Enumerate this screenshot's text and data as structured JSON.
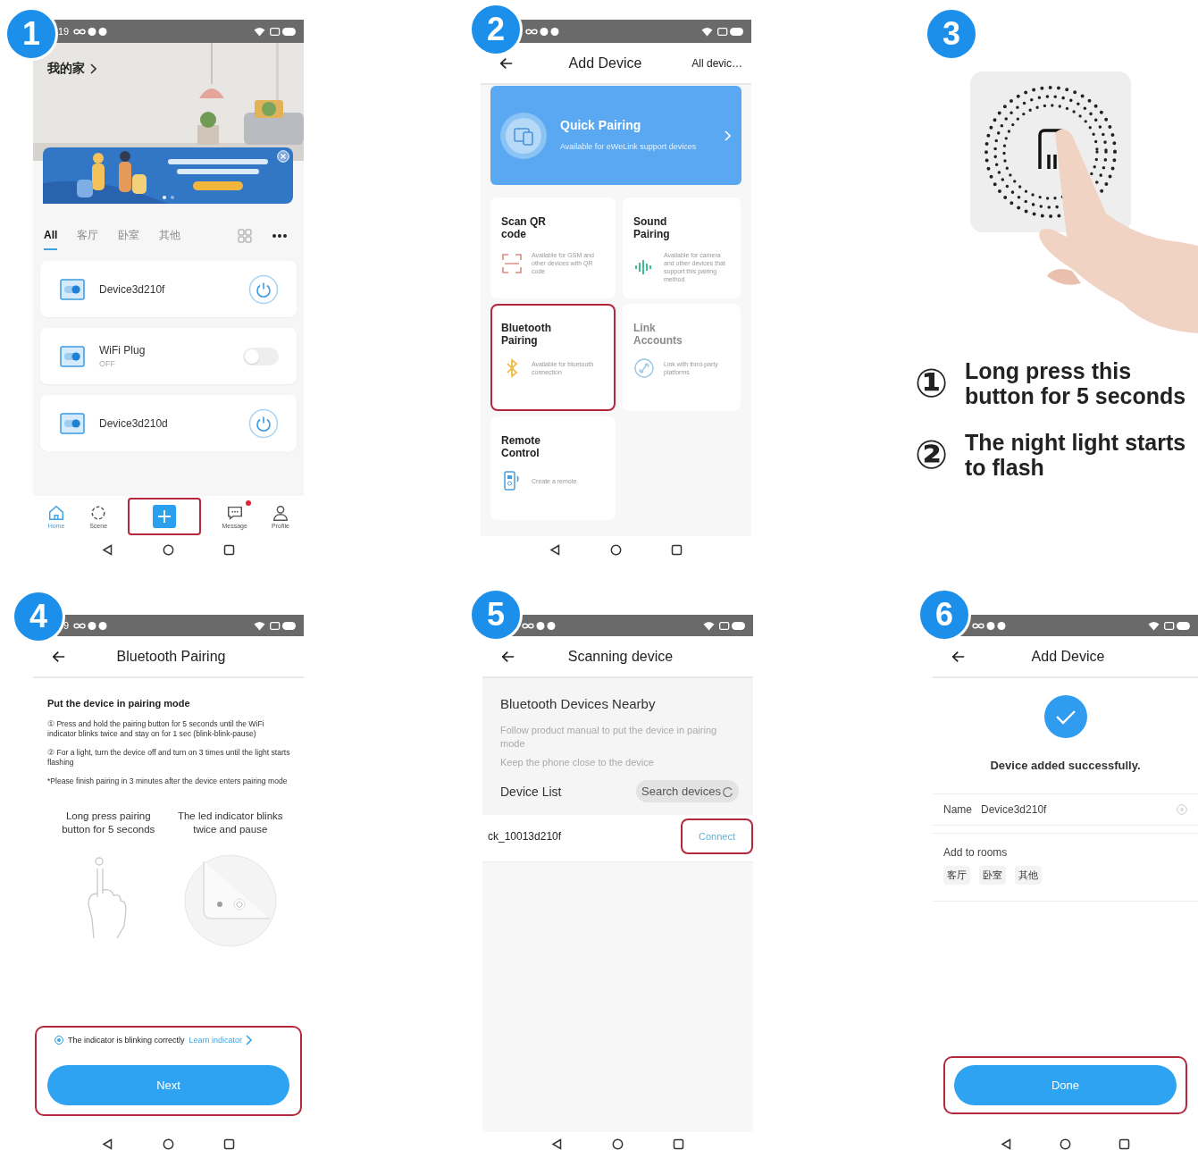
{
  "steps": [
    {
      "number": "1",
      "kind": "home",
      "status_time": "19",
      "home_title": "我的家",
      "rooms": [
        {
          "label": "All",
          "selected": true
        },
        {
          "label": "客厅",
          "selected": false
        },
        {
          "label": "卧室",
          "selected": false
        },
        {
          "label": "其他",
          "selected": false
        }
      ],
      "devices": [
        {
          "name": "Device3d210f",
          "kind": "power"
        },
        {
          "name": "WiFi Plug",
          "status": "OFF",
          "kind": "toggle",
          "on": false
        },
        {
          "name": "Device3d210d",
          "kind": "power"
        }
      ],
      "nav": [
        {
          "kind": "home",
          "label": "Home",
          "selected": true,
          "highlighted": false,
          "dot": false
        },
        {
          "kind": "scene",
          "label": "Scene",
          "selected": false,
          "highlighted": false,
          "dot": false
        },
        {
          "kind": "add",
          "selected": false,
          "highlighted": true,
          "dot": false
        },
        {
          "kind": "message",
          "label": "Message",
          "selected": false,
          "highlighted": false,
          "dot": true
        },
        {
          "kind": "profile",
          "label": "Profile",
          "selected": false,
          "highlighted": false,
          "dot": false
        }
      ]
    },
    {
      "number": "2",
      "kind": "add_device",
      "title": "Add Device",
      "action": "All devic…",
      "quick": {
        "title": "Quick Pairing",
        "text": "Available for eWeLink support devices"
      },
      "methods": [
        {
          "kind": "qr",
          "title": "Scan QR code",
          "text": "Available for GSM and other devices with QR code",
          "disabled": false,
          "highlighted": false
        },
        {
          "kind": "sound",
          "title": "Sound Pairing",
          "text": "Available for camera and other devices that support this pairing method",
          "disabled": false,
          "highlighted": false
        },
        {
          "kind": "bluetooth",
          "title": "Bluetooth Pairing",
          "text": "Available for bluetooth connection",
          "disabled": false,
          "highlighted": true
        },
        {
          "kind": "link",
          "title": "Link Accounts",
          "text": "Link with third-party platforms",
          "disabled": true,
          "highlighted": false
        },
        {
          "kind": "remote",
          "title": "Remote Control",
          "text": "Create a remote",
          "disabled": false,
          "highlighted": false
        }
      ]
    },
    {
      "number": "3",
      "kind": "instructions",
      "notes": [
        {
          "marker": "①",
          "text": "Long press this button for 5 seconds"
        },
        {
          "marker": "②",
          "text": "The night light starts to flash"
        }
      ]
    },
    {
      "number": "4",
      "kind": "pairing",
      "status_time": "9",
      "title": "Bluetooth Pairing",
      "heading": "Put the device in pairing mode",
      "paragraphs": [
        "① Press and hold the pairing button for 5 seconds until the WiFi indicator blinks twice and stay on for 1 sec (blink-blink-pause)",
        "② For a light, turn the device off and turn on 3 times until the light starts flashing",
        "*Please finish pairing in 3 minutes after the device enters pairing mode"
      ],
      "illustrations": [
        {
          "kind": "press",
          "caption": "Long press pairing button for 5 seconds"
        },
        {
          "kind": "led",
          "caption": "The led indicator blinks twice and pause"
        }
      ],
      "confirm": {
        "checked": true,
        "text": "The indicator is blinking correctly",
        "link": "Learn indicator"
      },
      "button": "Next",
      "highlighted": true
    },
    {
      "number": "5",
      "kind": "scanning",
      "title": "Scanning device",
      "heading": "Bluetooth Devices Nearby",
      "hints": [
        "Follow product manual to put the device in pairing mode",
        "Keep the phone close to the device"
      ],
      "list_label": "Device List",
      "search_button": "Search devices",
      "found": [
        {
          "name": "ck_10013d210f",
          "action": "Connect",
          "highlighted": true
        }
      ]
    },
    {
      "number": "6",
      "kind": "added",
      "title": "Add Device",
      "message": "Device added successfully.",
      "name_label": "Name",
      "name_value": "Device3d210f",
      "rooms_label": "Add to rooms",
      "rooms": [
        {
          "label": "客厅",
          "selected": false
        },
        {
          "label": "卧室",
          "selected": false
        },
        {
          "label": "其他",
          "selected": false
        }
      ],
      "button": "Done",
      "highlighted": true
    }
  ]
}
